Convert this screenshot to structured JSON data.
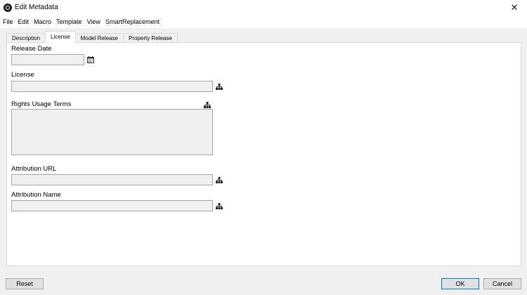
{
  "window": {
    "title": "Edit Metadata",
    "app_icon": "app-logo-icon",
    "close_icon": "close-icon"
  },
  "menu": [
    "File",
    "Edit",
    "Macro",
    "Template",
    "View",
    "SmartReplacement"
  ],
  "tabs": [
    {
      "label": "Description",
      "active": false
    },
    {
      "label": "License",
      "active": true
    },
    {
      "label": "Model Release",
      "active": false
    },
    {
      "label": "Property Release",
      "active": false
    }
  ],
  "license_tab": {
    "release_date": {
      "label": "Release Date",
      "value": "",
      "icon": "calendar-icon"
    },
    "license": {
      "label": "License",
      "value": "",
      "icon": "hierarchy-icon"
    },
    "rights_usage_terms": {
      "label": "Rights Usage Terms",
      "value": "",
      "icon": "hierarchy-icon"
    },
    "attribution_url": {
      "label": "Attribution URL",
      "value": "",
      "icon": "hierarchy-icon"
    },
    "attribution_name": {
      "label": "Attribution Name",
      "value": "",
      "icon": "hierarchy-icon"
    }
  },
  "buttons": {
    "reset": "Reset",
    "ok": "OK",
    "cancel": "Cancel"
  },
  "colors": {
    "focus_border": "#0078d7",
    "field_bg": "#f0f0f0"
  }
}
